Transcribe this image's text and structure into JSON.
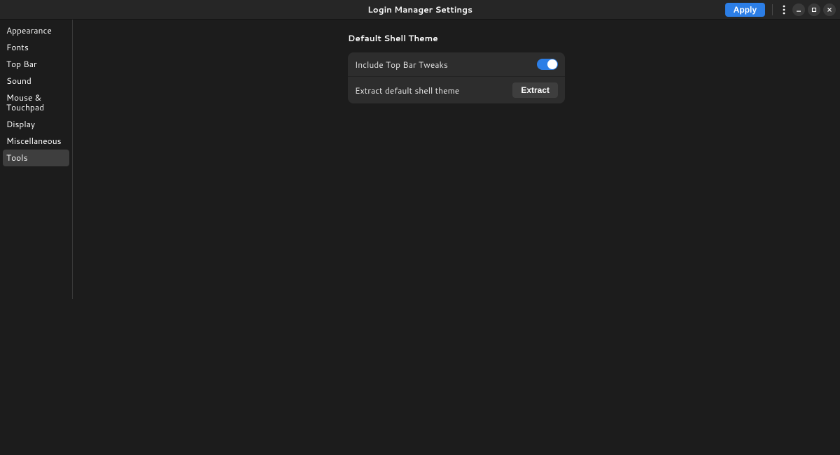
{
  "header": {
    "title": "Login Manager Settings",
    "apply_label": "Apply"
  },
  "sidebar": {
    "items": [
      {
        "label": "Appearance",
        "active": false
      },
      {
        "label": "Fonts",
        "active": false
      },
      {
        "label": "Top Bar",
        "active": false
      },
      {
        "label": "Sound",
        "active": false
      },
      {
        "label": "Mouse & Touchpad",
        "active": false
      },
      {
        "label": "Display",
        "active": false
      },
      {
        "label": "Miscellaneous",
        "active": false
      },
      {
        "label": "Tools",
        "active": true
      }
    ]
  },
  "main": {
    "section_title": "Default Shell Theme",
    "rows": {
      "topbar_tweaks": {
        "label": "Include Top Bar Tweaks",
        "toggle_on": true
      },
      "extract": {
        "label": "Extract default shell theme",
        "button_label": "Extract"
      }
    }
  },
  "colors": {
    "accent": "#2c7ee6",
    "background": "#1c1c1c",
    "header_bg": "#262626",
    "group_bg": "#2d2d2d"
  }
}
